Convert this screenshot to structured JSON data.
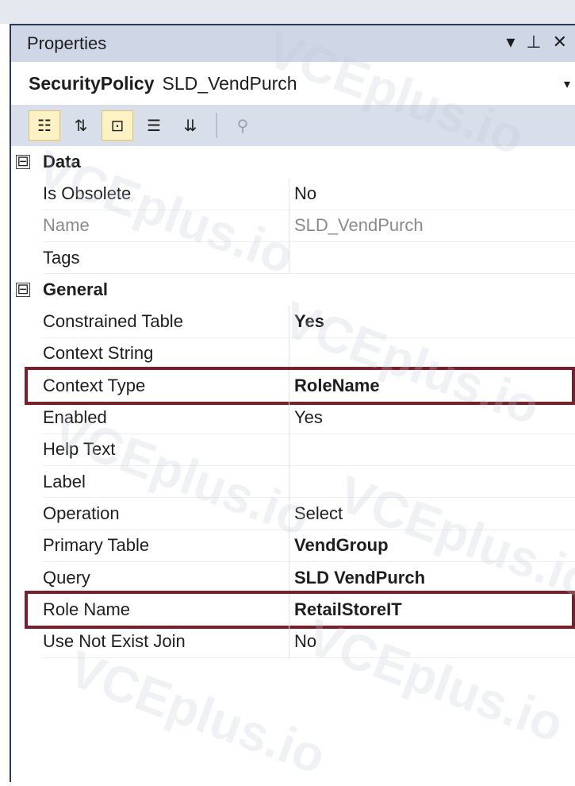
{
  "window": {
    "title": "Properties",
    "icons": [
      "dropdown-icon",
      "pin-icon",
      "close-icon"
    ]
  },
  "selector": {
    "type": "SecurityPolicy",
    "name": "SLD_VendPurch"
  },
  "toolbar": {
    "buttons": [
      "categorized-icon",
      "alphabetical-icon",
      "properties-icon",
      "events-icon",
      "sort-icon",
      "property-pages-icon"
    ]
  },
  "categories": [
    {
      "label": "Data",
      "toggle": "⊟",
      "properties": [
        {
          "name": "Is Obsolete",
          "value": "No",
          "bold": false,
          "muted": false
        },
        {
          "name": "Name",
          "value": "SLD_VendPurch",
          "bold": false,
          "muted": true
        },
        {
          "name": "Tags",
          "value": "",
          "bold": false,
          "muted": false
        }
      ]
    },
    {
      "label": "General",
      "toggle": "⊟",
      "properties": [
        {
          "name": "Constrained Table",
          "value": "Yes",
          "bold": true,
          "muted": false
        },
        {
          "name": "Context String",
          "value": "",
          "bold": false,
          "muted": false
        },
        {
          "name": "Context Type",
          "value": "RoleName",
          "bold": true,
          "muted": false,
          "highlighted": true
        },
        {
          "name": "Enabled",
          "value": "Yes",
          "bold": false,
          "muted": false
        },
        {
          "name": "Help Text",
          "value": "",
          "bold": false,
          "muted": false
        },
        {
          "name": "Label",
          "value": "",
          "bold": false,
          "muted": false
        },
        {
          "name": "Operation",
          "value": "Select",
          "bold": false,
          "muted": false
        },
        {
          "name": "Primary Table",
          "value": "VendGroup",
          "bold": true,
          "muted": false
        },
        {
          "name": "Query",
          "value": "SLD VendPurch",
          "bold": true,
          "muted": false
        },
        {
          "name": "Role Name",
          "value": "RetailStoreIT",
          "bold": true,
          "muted": false,
          "highlighted": true
        },
        {
          "name": "Use Not Exist Join",
          "value": "No",
          "bold": false,
          "muted": false
        }
      ]
    }
  ],
  "watermark": "VCEplus.io"
}
